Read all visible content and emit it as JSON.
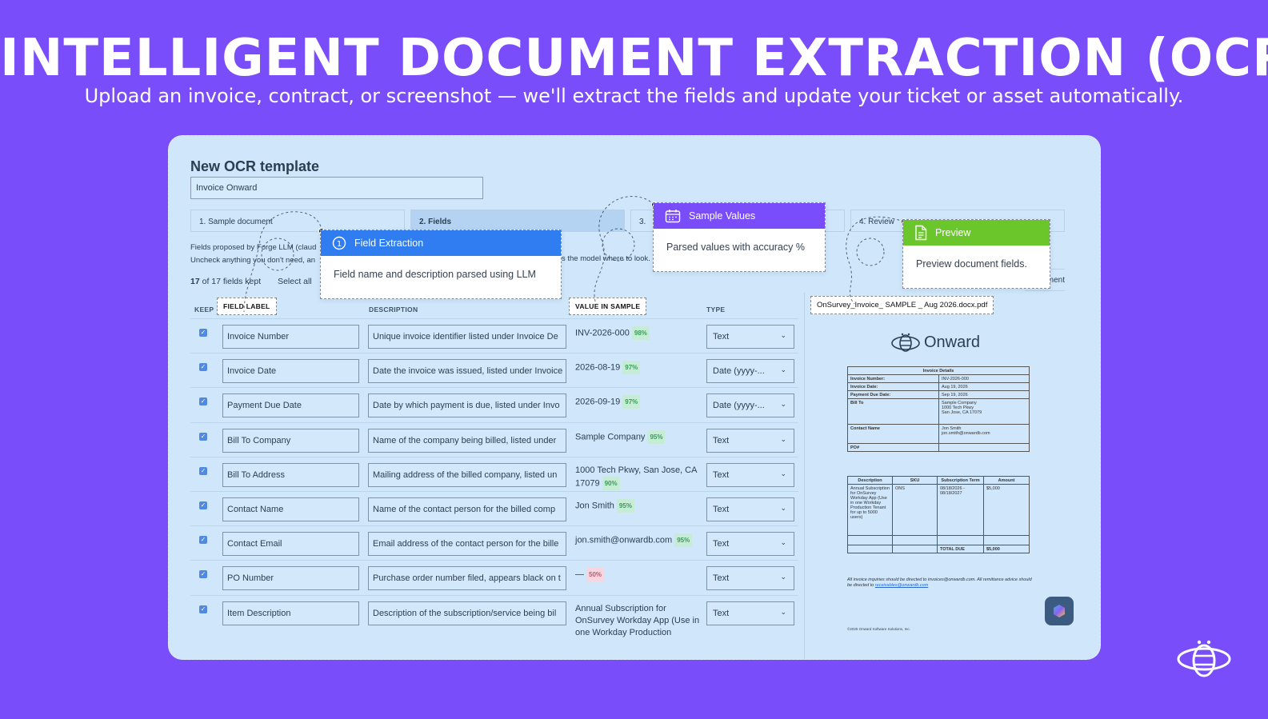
{
  "hero": {
    "title": "INTELLIGENT DOCUMENT EXTRACTION (OCR)",
    "subtitle": "Upload an invoice, contract, or screenshot — we'll extract the fields and update your ticket or asset automatically."
  },
  "form": {
    "page_title": "New OCR template",
    "template_name": "Invoice Onward",
    "steps": [
      "1. Sample document",
      "2. Fields",
      "3.",
      "4. Review"
    ],
    "info_line1": "Fields proposed by Forge LLM (claud",
    "info_line1_tail": "",
    "info_line2": "Uncheck anything you don't need, an",
    "info_line2_tail": "s the model where to look.",
    "count_num": "17",
    "count_text": "of 17 fields kept",
    "select_all": "Select all",
    "doc_button_fragment": "ment"
  },
  "table": {
    "headers": {
      "keep": "KEEP",
      "label": "FIELD LABEL",
      "description": "DESCRIPTION",
      "value": "VALUE IN SAMPLE",
      "type": "TYPE"
    },
    "rows": [
      {
        "label": "Invoice Number",
        "description": "Unique invoice identifier listed under Invoice De",
        "value": "INV-2026-000",
        "pct": "98%",
        "type": "Text"
      },
      {
        "label": "Invoice Date",
        "description": "Date the invoice was issued, listed under Invoice",
        "value": "2026-08-19",
        "pct": "97%",
        "type": "Date (yyyy-..."
      },
      {
        "label": "Payment Due Date",
        "description": "Date by which payment is due, listed under Invo",
        "value": "2026-09-19",
        "pct": "97%",
        "type": "Date (yyyy-..."
      },
      {
        "label": "Bill To Company",
        "description": "Name of the company being billed, listed under",
        "value": "Sample Company",
        "pct": "95%",
        "type": "Text"
      },
      {
        "label": "Bill To Address",
        "description": "Mailing address of the billed company, listed un",
        "value": "1000 Tech Pkwy, San Jose, CA 17079",
        "pct": "90%",
        "type": "Text"
      },
      {
        "label": "Contact Name",
        "description": "Name of the contact person for the billed comp",
        "value": "Jon Smith",
        "pct": "95%",
        "type": "Text"
      },
      {
        "label": "Contact Email",
        "description": "Email address of the contact person for the bille",
        "value": "jon.smith@onwardb.com",
        "pct": "95%",
        "type": "Text"
      },
      {
        "label": "PO Number",
        "description": "Purchase order number filed, appears black on t",
        "value": "—",
        "pct": "50%",
        "type": "Text"
      },
      {
        "label": "Item Description",
        "description": "Description of the subscription/service being bil",
        "value": "Annual Subscription for OnSurvey Workday App (Use in one Workday Production",
        "pct": "",
        "type": "Text"
      }
    ]
  },
  "preview": {
    "file_name": "OnSurvey_Invoice_ SAMPLE _ Aug 2026.docx.pdf",
    "brand": "Onward",
    "details_title": "Invoice Details",
    "details": [
      [
        "Invoice Number:",
        "INV-2026-000"
      ],
      [
        "Invoice Date:",
        "Aug 19, 2026"
      ],
      [
        "Payment Due Date:",
        "Sep 19, 2026"
      ],
      [
        "Bill To",
        "Sample Company\n1000 Tech Pkwy\nSan Jose, CA 17079"
      ],
      [
        "Contact Name",
        "Jon Smith\njon.smith@onwardb.com"
      ],
      [
        "PO#",
        ""
      ]
    ],
    "items_headers": [
      "Description",
      "SKU",
      "Subscription Term",
      "Amount"
    ],
    "item_row": [
      "Annual Subscription for OnSurvey Workday App (Use in one Workday Production Tenant for up to 5000 users)",
      "ONS",
      "08/18/2026 - 08/18/2027",
      "$5,000"
    ],
    "total_label": "TOTAL DUE",
    "total_value": "$5,000",
    "footer_text": "All invoice inquiries should be directed to invoices@onwardb.com. All remittance advice should be directed to ",
    "footer_link": "receivables@onwardb.com",
    "copyright": "©2025 Onward Software Solutions, Inc."
  },
  "callouts": {
    "field_extraction": {
      "number": "1",
      "title": "Field Extraction",
      "body": "Field name and description parsed using LLM",
      "color": "#2f7df0"
    },
    "sample_values": {
      "title": "Sample Values",
      "body": "Parsed values with accuracy %",
      "color": "#7a4dfa"
    },
    "preview": {
      "title": "Preview",
      "body": "Preview document fields.",
      "color": "#6ac62b"
    }
  },
  "icons": [
    "number-one-icon",
    "calendar-icon",
    "document-icon",
    "chevron-down-icon",
    "checkbox-icon",
    "onward-bee-logo",
    "chat-assistant-icon"
  ]
}
